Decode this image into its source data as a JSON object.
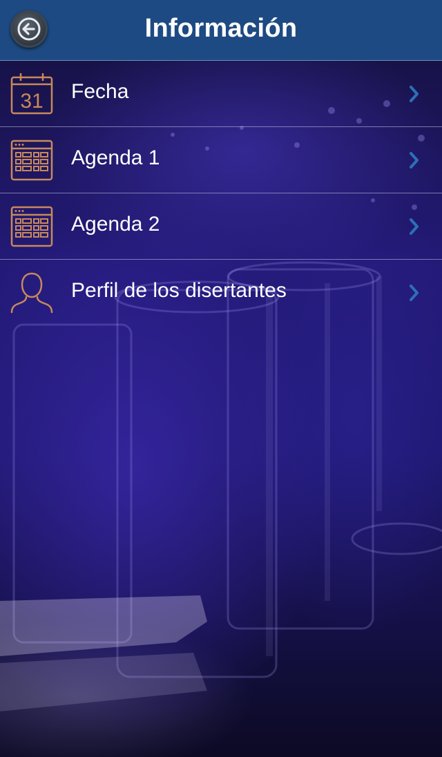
{
  "header": {
    "title": "Información"
  },
  "menu": {
    "items": [
      {
        "label": "Fecha",
        "icon": "calendar-date-icon",
        "date_number": "31"
      },
      {
        "label": "Agenda 1",
        "icon": "agenda-calendar-icon"
      },
      {
        "label": "Agenda 2",
        "icon": "agenda-calendar-icon"
      },
      {
        "label": "Perfil de los disertantes",
        "icon": "person-icon"
      }
    ]
  },
  "colors": {
    "header_bg": "#1d4a82",
    "icon_accent": "#c9895a",
    "chevron": "#2d6fb8"
  }
}
